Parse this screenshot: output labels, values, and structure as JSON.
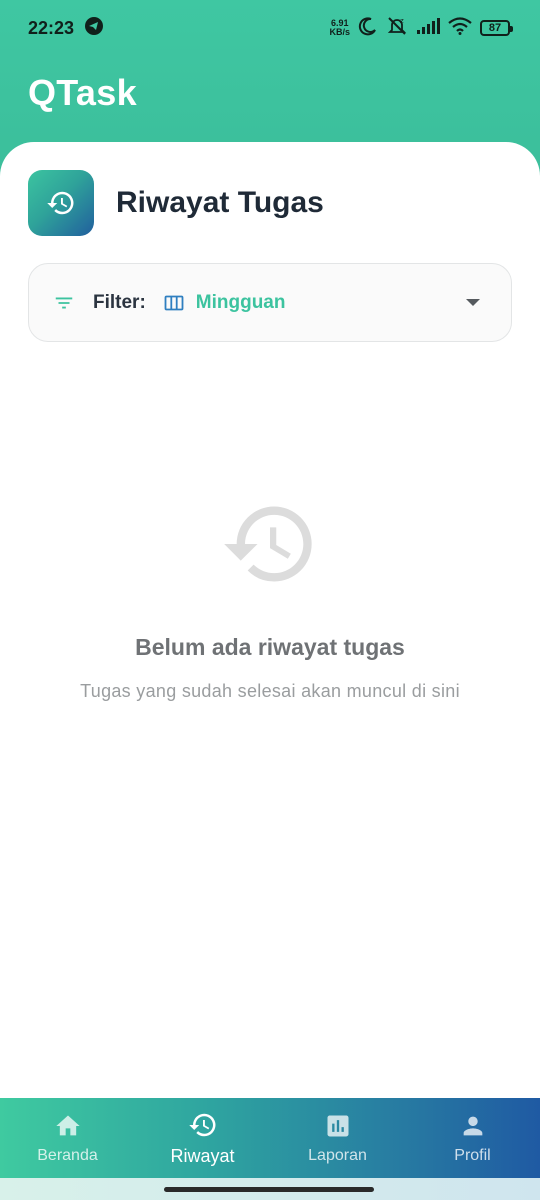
{
  "status_bar": {
    "time": "22:23",
    "net_speed_value": "6.91",
    "net_speed_unit": "KB/s",
    "battery": "87"
  },
  "app": {
    "title": "QTask",
    "accent_color": "#3cc39f",
    "brand_gradient": [
      "#3fcaa0",
      "#1f5aa3"
    ]
  },
  "page": {
    "title": "Riwayat Tugas",
    "header_icon": "history-icon"
  },
  "filter": {
    "label": "Filter:",
    "value": "Mingguan",
    "icons": [
      "filter-icon",
      "view-week-icon",
      "dropdown-arrow-icon"
    ]
  },
  "empty_state": {
    "icon": "history-icon",
    "title": "Belum ada riwayat tugas",
    "subtitle": "Tugas yang sudah selesai akan muncul di sini"
  },
  "bottom_nav": {
    "items": [
      {
        "label": "Beranda",
        "icon": "home-icon",
        "active": false
      },
      {
        "label": "Riwayat",
        "icon": "history-icon",
        "active": true
      },
      {
        "label": "Laporan",
        "icon": "bar-chart-icon",
        "active": false
      },
      {
        "label": "Profil",
        "icon": "person-icon",
        "active": false
      }
    ]
  }
}
